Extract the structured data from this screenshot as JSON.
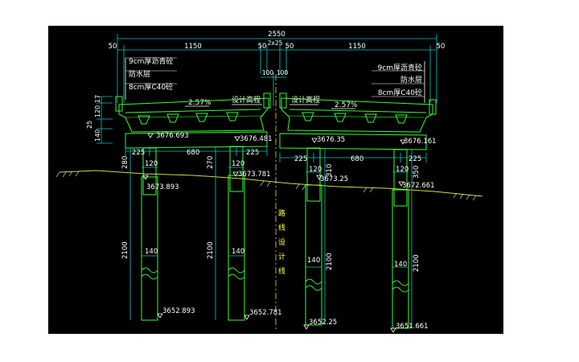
{
  "colors": {
    "background": "#000000",
    "page": "#ffffff",
    "dimension": "#00c8c8",
    "structure": "#30ff30",
    "text": "#ffffff",
    "ground": "#d8d840",
    "centerline": "#ffff40"
  },
  "dims_top": {
    "overall": "2550",
    "left_edge": "50",
    "left_span": "1150",
    "mid_left": "50",
    "median": "2x25",
    "mid_right": "50",
    "right_span": "1150",
    "right_edge": "50",
    "joint_left": "100",
    "joint_right": "100"
  },
  "pavement_left": [
    "9cm厚沥青砼",
    "防水层",
    "8cm厚C40砼"
  ],
  "pavement_right": [
    "9cm厚沥青砼",
    "防水层",
    "8cm厚C40砼"
  ],
  "slope_left": "2.57%",
  "slope_right": "2.57%",
  "design_elev_left": "设计高程",
  "design_elev_right": "设计高程",
  "girder_heights": {
    "a": "17",
    "b": "120",
    "c": "25",
    "d": "140"
  },
  "centerline_label": "路线设计线",
  "left_bridge": {
    "col_left_top": "3676.693",
    "col_right_top": "3676.481",
    "cap_left": "225",
    "cap_mid": "680",
    "cap_right": "225",
    "col_dia_l": "120",
    "col_dia_r": "120",
    "col_h_l": "280",
    "col_h_r": "270",
    "ground_l": "3673.893",
    "ground_r": "3673.781",
    "pile_dia_l": "140",
    "pile_dia_r": "140",
    "pile_len_l": "2100",
    "pile_len_r": "2100",
    "pile_bot_l": "3652.893",
    "pile_bot_r": "3652.781"
  },
  "right_bridge": {
    "col_left_top": "3676.35",
    "col_right_top": "3676.161",
    "cap_left": "225",
    "cap_mid": "680",
    "cap_right": "225",
    "col_dia_l": "120",
    "col_dia_r": "120",
    "col_h_l": "310",
    "col_h_r": "350",
    "ground_l": "3673.25",
    "ground_r": "3672.661",
    "pile_dia_l": "140",
    "pile_dia_r": "140",
    "pile_len_l": "2100",
    "pile_len_r": "2100",
    "pile_bot_l": "3652.25",
    "pile_bot_r": "3651.661"
  }
}
